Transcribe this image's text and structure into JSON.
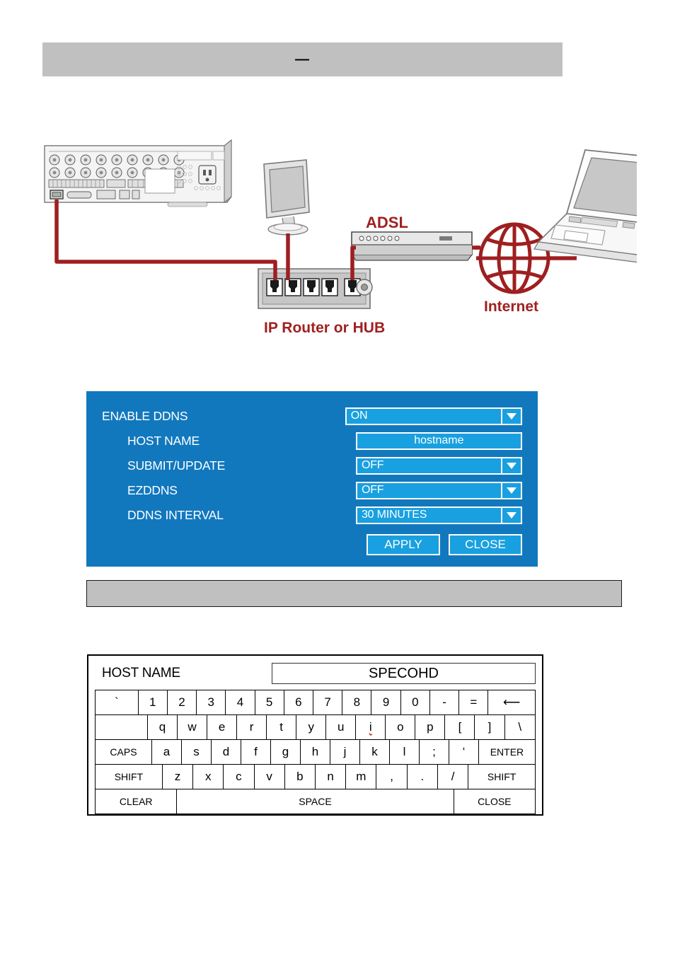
{
  "page": {
    "header_band_text": "—",
    "caption_band_text": ""
  },
  "diagram": {
    "labels": {
      "adsl": "ADSL",
      "internet": "Internet",
      "router": "IP Router or HUB"
    },
    "colors": {
      "cable": "#9e1f20",
      "label_text": "#a02020",
      "device_body": "#d9d9d9",
      "device_stroke": "#6d6d6d"
    },
    "icon_names": [
      "dvr-rear-panel",
      "monitor",
      "ip-router-hub",
      "adsl-modem",
      "internet-globe",
      "laptop"
    ]
  },
  "ddns_dialog": {
    "colors": {
      "panel_bg": "#1278be",
      "field_bg": "#19a0e0",
      "field_border": "#ffffff",
      "text": "#ffffff"
    },
    "rows": [
      {
        "label": "ENABLE DDNS",
        "value": "ON",
        "type": "select",
        "indent": false
      },
      {
        "label": "HOST NAME",
        "value": "hostname",
        "type": "text",
        "indent": true
      },
      {
        "label": "SUBMIT/UPDATE",
        "value": "OFF",
        "type": "select",
        "indent": true
      },
      {
        "label": "EZDDNS",
        "value": "OFF",
        "type": "select",
        "indent": true
      },
      {
        "label": "DDNS INTERVAL",
        "value": "30 MINUTES",
        "type": "select",
        "indent": true
      }
    ],
    "apply_label": "APPLY",
    "close_label": "CLOSE"
  },
  "keyboard_dialog": {
    "title_label": "HOST NAME",
    "value": "SPECOHD",
    "rows": [
      {
        "keys": [
          {
            "label": "`",
            "flex": 2.0
          },
          {
            "label": "1",
            "flex": 1.35
          },
          {
            "label": "2",
            "flex": 1.35
          },
          {
            "label": "3",
            "flex": 1.35
          },
          {
            "label": "4",
            "flex": 1.35
          },
          {
            "label": "5",
            "flex": 1.35
          },
          {
            "label": "6",
            "flex": 1.35
          },
          {
            "label": "7",
            "flex": 1.35
          },
          {
            "label": "8",
            "flex": 1.35
          },
          {
            "label": "9",
            "flex": 1.35
          },
          {
            "label": "0",
            "flex": 1.35
          },
          {
            "label": "-",
            "flex": 1.35
          },
          {
            "label": "=",
            "flex": 1.35
          },
          {
            "label": "⟵",
            "flex": 2.2
          }
        ]
      },
      {
        "keys": [
          {
            "label": "",
            "flex": 2.4,
            "blank": true
          },
          {
            "label": "q",
            "flex": 1.35
          },
          {
            "label": "w",
            "flex": 1.35
          },
          {
            "label": "e",
            "flex": 1.35
          },
          {
            "label": "r",
            "flex": 1.35
          },
          {
            "label": "t",
            "flex": 1.35
          },
          {
            "label": "y",
            "flex": 1.35
          },
          {
            "label": "u",
            "flex": 1.35
          },
          {
            "label": "i",
            "flex": 1.35,
            "spell": true
          },
          {
            "label": "o",
            "flex": 1.35
          },
          {
            "label": "p",
            "flex": 1.35
          },
          {
            "label": "[",
            "flex": 1.35
          },
          {
            "label": "]",
            "flex": 1.35
          },
          {
            "label": "\\",
            "flex": 1.4
          }
        ]
      },
      {
        "keys": [
          {
            "label": "CAPS",
            "flex": 2.6,
            "wide": true
          },
          {
            "label": "a",
            "flex": 1.35
          },
          {
            "label": "s",
            "flex": 1.35
          },
          {
            "label": "d",
            "flex": 1.35
          },
          {
            "label": "f",
            "flex": 1.35
          },
          {
            "label": "g",
            "flex": 1.35
          },
          {
            "label": "h",
            "flex": 1.35
          },
          {
            "label": "j",
            "flex": 1.35
          },
          {
            "label": "k",
            "flex": 1.35
          },
          {
            "label": "l",
            "flex": 1.35
          },
          {
            "label": ";",
            "flex": 1.35
          },
          {
            "label": "‘",
            "flex": 1.35
          },
          {
            "label": "ENTER",
            "flex": 2.6,
            "wide": true
          }
        ]
      },
      {
        "keys": [
          {
            "label": "SHIFT",
            "flex": 3.0,
            "wide": true
          },
          {
            "label": "z",
            "flex": 1.35
          },
          {
            "label": "x",
            "flex": 1.35
          },
          {
            "label": "c",
            "flex": 1.35
          },
          {
            "label": "v",
            "flex": 1.35
          },
          {
            "label": "b",
            "flex": 1.35
          },
          {
            "label": "n",
            "flex": 1.35
          },
          {
            "label": "m",
            "flex": 1.35
          },
          {
            "label": ",",
            "flex": 1.35
          },
          {
            "label": ".",
            "flex": 1.35
          },
          {
            "label": "/",
            "flex": 1.35
          },
          {
            "label": "SHIFT",
            "flex": 3.0,
            "wide": true
          }
        ]
      },
      {
        "keys": [
          {
            "label": "CLEAR",
            "flex": 3.4,
            "wide": true
          },
          {
            "label": "SPACE",
            "flex": 11.6,
            "wide": true
          },
          {
            "label": "CLOSE",
            "flex": 3.4,
            "wide": true
          }
        ]
      }
    ]
  }
}
